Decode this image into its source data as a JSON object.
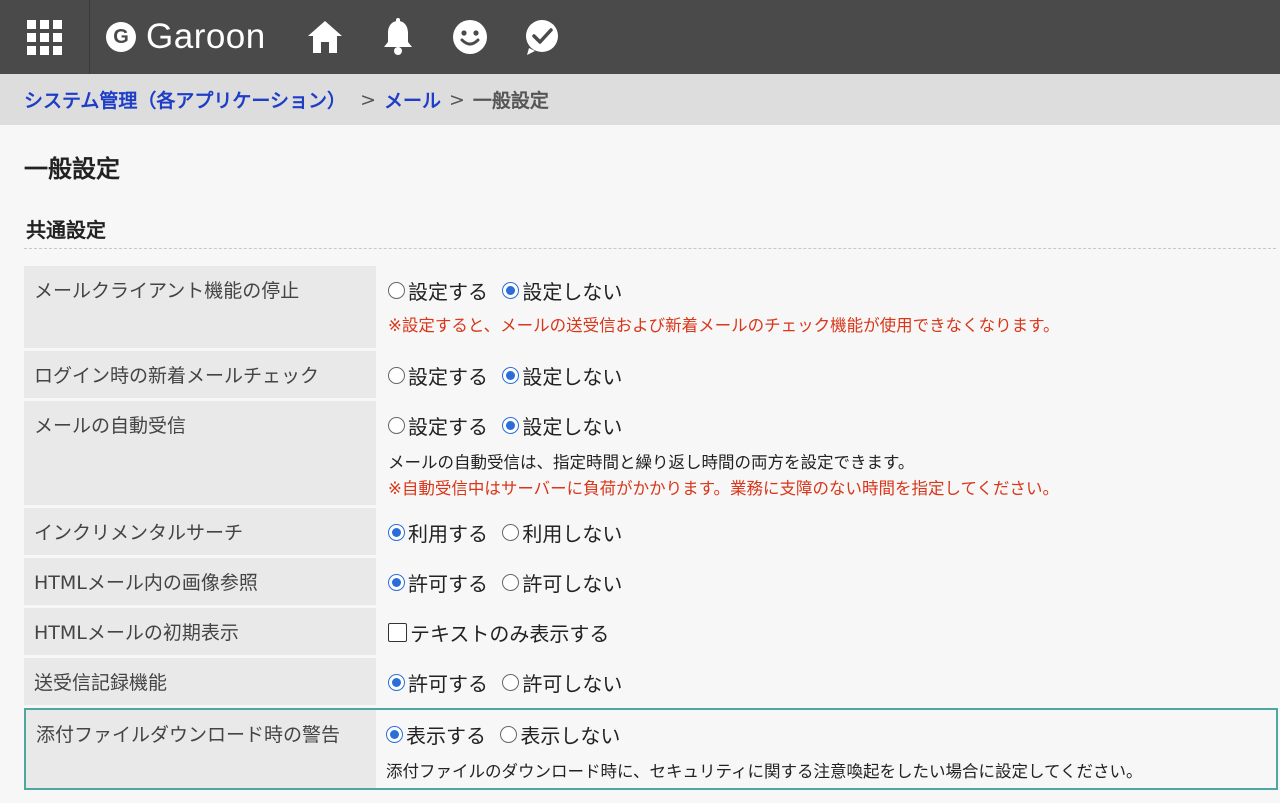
{
  "header": {
    "logo_mark": "G",
    "logo_text": "Garoon",
    "icons": [
      "apps-grid-icon",
      "home-icon",
      "bell-icon",
      "smiley-icon",
      "check-bubble-icon"
    ]
  },
  "breadcrumb": {
    "items": [
      "システム管理（各アプリケーション）",
      "メール"
    ],
    "current": "一般設定",
    "separator": ">"
  },
  "page_title": "一般設定",
  "section_title": "共通設定",
  "rows": [
    {
      "label": "メールクライアント機能の停止",
      "options": [
        "設定する",
        "設定しない"
      ],
      "selected": 1,
      "note_red": "※設定すると、メールの送受信および新着メールのチェック機能が使用できなくなります。"
    },
    {
      "label": "ログイン時の新着メールチェック",
      "options": [
        "設定する",
        "設定しない"
      ],
      "selected": 1
    },
    {
      "label": "メールの自動受信",
      "options": [
        "設定する",
        "設定しない"
      ],
      "selected": 1,
      "note": "メールの自動受信は、指定時間と繰り返し時間の両方を設定できます。",
      "note_red": "※自動受信中はサーバーに負荷がかかります。業務に支障のない時間を指定してください。"
    },
    {
      "label": "インクリメンタルサーチ",
      "options": [
        "利用する",
        "利用しない"
      ],
      "selected": 0
    },
    {
      "label": "HTMLメール内の画像参照",
      "options": [
        "許可する",
        "許可しない"
      ],
      "selected": 0
    },
    {
      "label": "HTMLメールの初期表示",
      "checkbox_label": "テキストのみ表示する",
      "checked": false
    },
    {
      "label": "送受信記録機能",
      "options": [
        "許可する",
        "許可しない"
      ],
      "selected": 0
    },
    {
      "label": "添付ファイルダウンロード時の警告",
      "options": [
        "表示する",
        "表示しない"
      ],
      "selected": 0,
      "note": "添付ファイルのダウンロード時に、セキュリティに関する注意喚起をしたい場合に設定してください。"
    }
  ],
  "colors": {
    "topbar": "#4a4a4a",
    "link": "#1e3ec8",
    "radio_selected": "#2a6ed8",
    "warning": "#d9361a",
    "highlight_border": "#4fa89f"
  }
}
